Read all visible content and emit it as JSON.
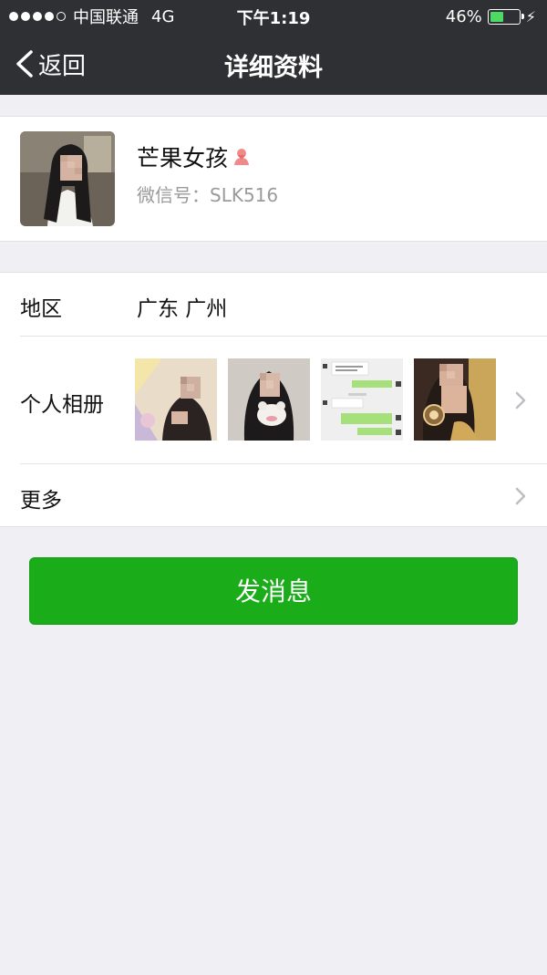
{
  "status_bar": {
    "carrier": "中国联通",
    "network": "4G",
    "time": "下午1:19",
    "battery_percent": "46%",
    "battery_level": 0.46,
    "signal_strength": "4 of 5"
  },
  "nav": {
    "back_label": "返回",
    "title": "详细资料"
  },
  "profile": {
    "name": "芒果女孩",
    "gender_icon": "female-icon",
    "wechat_id": "微信号：SLK516"
  },
  "details": {
    "region_label": "地区",
    "region_value": "广东 广州",
    "album_label": "个人相册",
    "album_thumbnails": [
      "photo-selfie-blurred",
      "photo-girl-with-toy-blurred",
      "photo-chat-screenshot",
      "photo-selfie-with-drink-blurred"
    ],
    "more_label": "更多"
  },
  "actions": {
    "send_message": "发消息"
  },
  "colors": {
    "nav_background": "#2f3033",
    "page_background": "#efeff4",
    "button_green": "#1aad19",
    "secondary_text": "#9a9a9a"
  }
}
